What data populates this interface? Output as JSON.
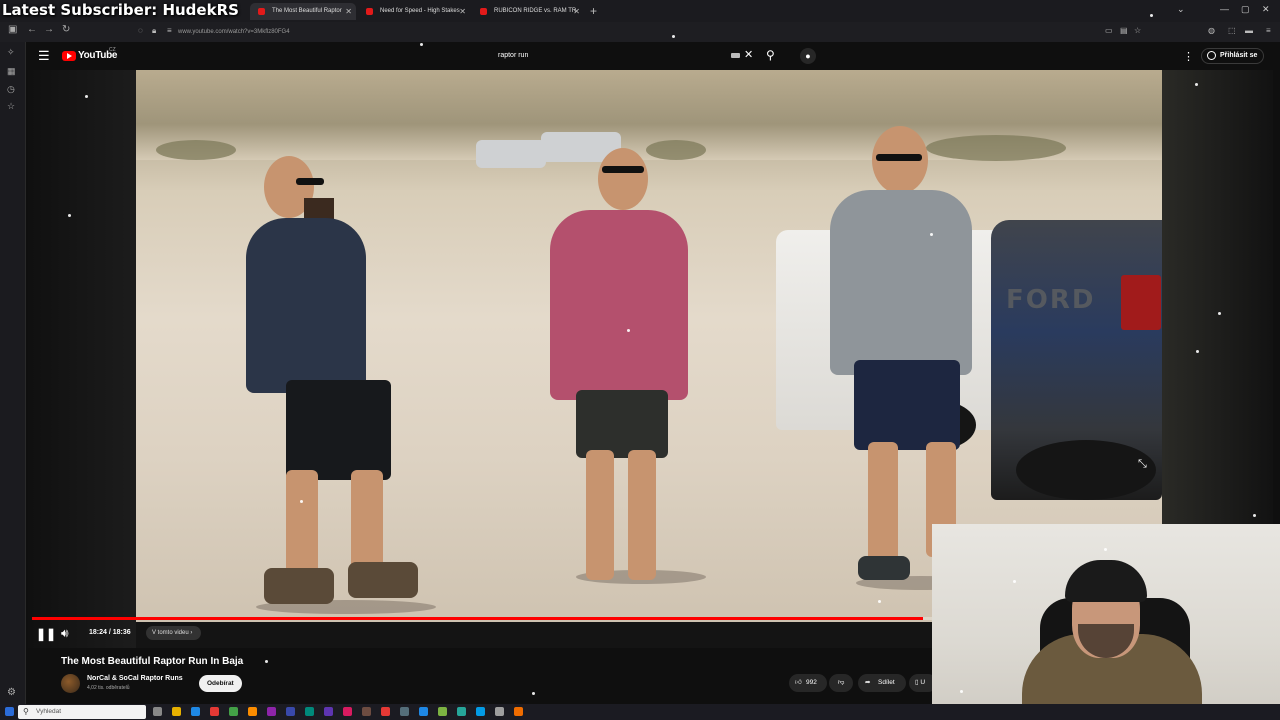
{
  "overlay": {
    "title": "Latest Subscriber: HudekRS"
  },
  "browser": {
    "tabs": [
      {
        "label": "The Most Beautiful Raptor",
        "active": true
      },
      {
        "label": "Need for Speed - High Stakes",
        "active": false
      },
      {
        "label": "RUBICON RIDGE vs. RAM TR",
        "active": false
      }
    ],
    "url": "www.youtube.com/watch?v=3Mkflz80FG4",
    "icons": [
      "back-icon",
      "forward-icon",
      "reload-icon",
      "shield-icon",
      "lock-icon",
      "new-tab-icon",
      "minimize-icon",
      "maximize-icon",
      "close-icon"
    ]
  },
  "youtube": {
    "logo_text": "YouTube",
    "logo_sup": "CZ",
    "search_value": "raptor run",
    "sign_in": "Přihlásit se"
  },
  "player": {
    "time": "18:24 / 18:36",
    "chapter": "V tomto videu",
    "progress": 0.72,
    "accent": "#ff0000"
  },
  "video": {
    "title": "The Most Beautiful Raptor Run In Baja",
    "channel": "NorCal & SoCal Raptor Runs",
    "subscribers": "4,02 tis. odběratelů",
    "subscribe": "Odebírat",
    "likes": "992",
    "share": "Sdílet",
    "save": "U"
  },
  "taskbar": {
    "search": "Vyhledat"
  }
}
